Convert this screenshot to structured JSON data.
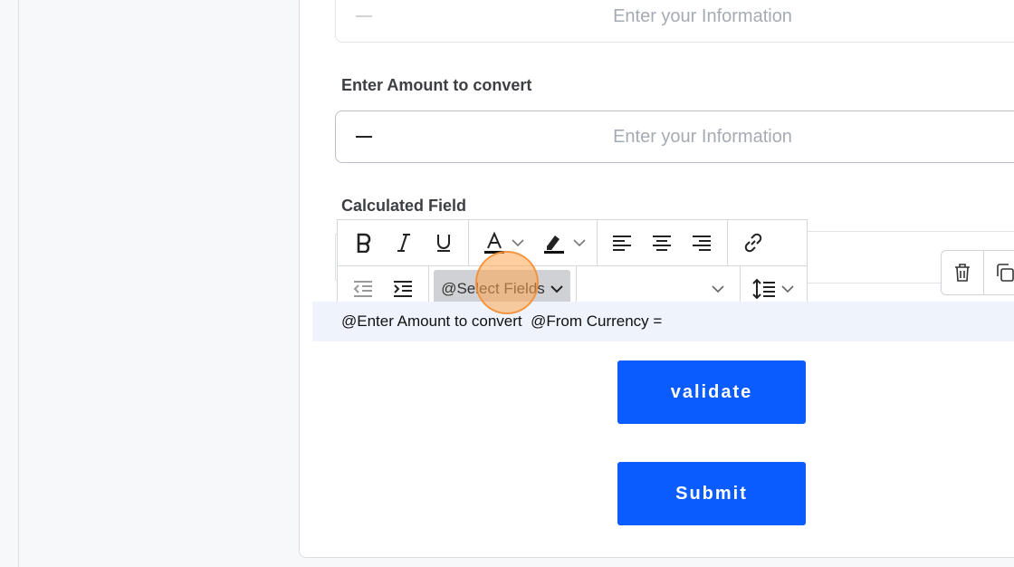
{
  "fields": [
    {
      "placeholder": "Enter your Information"
    },
    {
      "label": "Enter Amount to convert",
      "placeholder": "Enter your Information"
    }
  ],
  "calculated": {
    "label": "Calculated Field",
    "select_fields_label": "@Select Fields",
    "content": "@Enter Amount to convert  @From Currency ="
  },
  "buttons": {
    "validate": "validate",
    "submit": "Submit"
  },
  "colors": {
    "primary": "#0b5cff",
    "editor_line": "#eef3fc"
  }
}
